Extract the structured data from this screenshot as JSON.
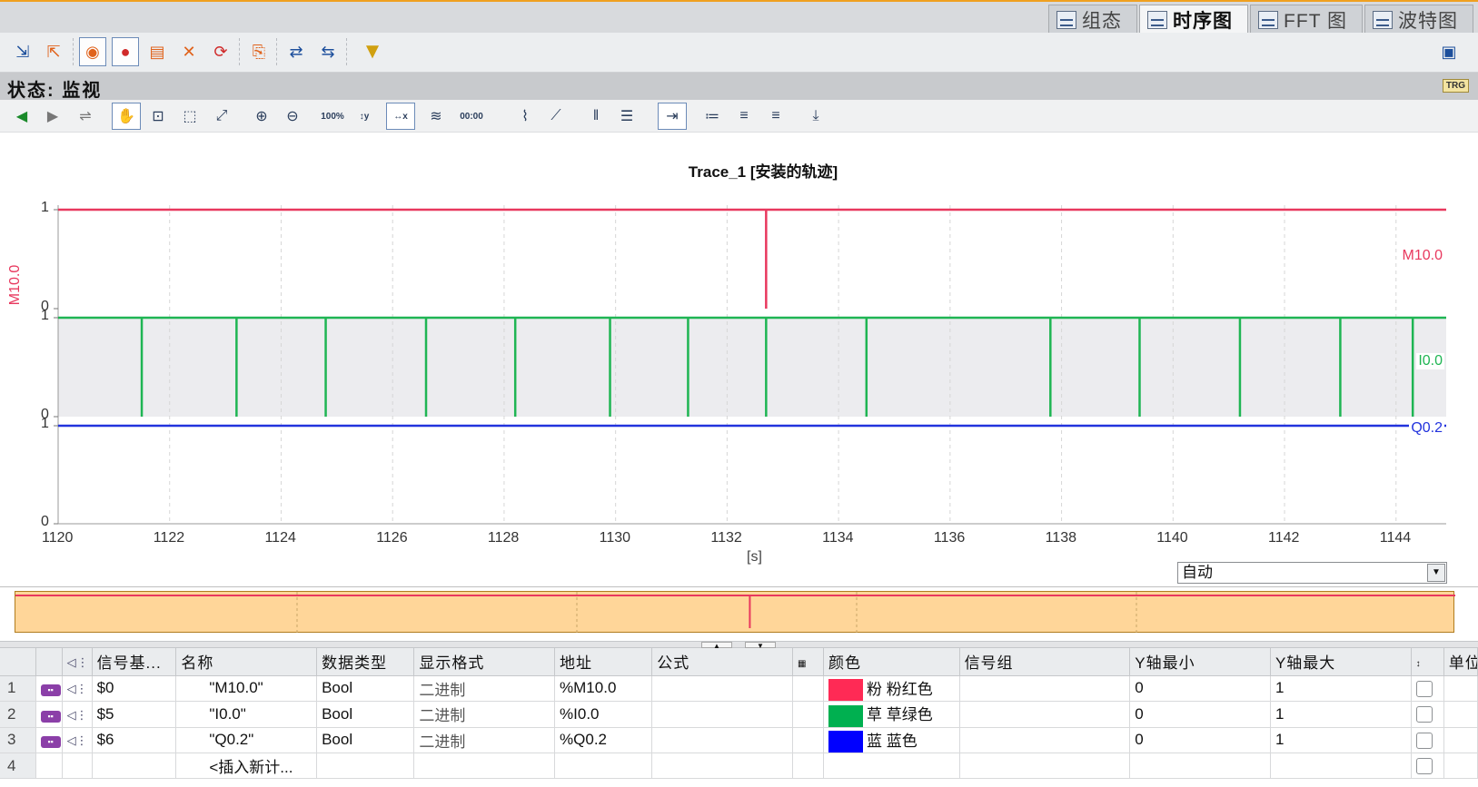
{
  "tabs": [
    {
      "label": "组态",
      "active": false
    },
    {
      "label": "时序图",
      "active": true
    },
    {
      "label": "FFT 图",
      "active": false
    },
    {
      "label": "波特图",
      "active": false
    }
  ],
  "status": {
    "text": "状态: 监视",
    "trigger_badge": "TRG"
  },
  "toolbar_icons": [
    "download-icon",
    "upload-icon",
    "signal-view-icon",
    "signal-record-icon",
    "signal-add-icon",
    "signal-delete-icon",
    "refresh-icon",
    "export-icon",
    "transfer-in-icon",
    "transfer-out-icon",
    "filter-icon"
  ],
  "chart_toolbar_icons": [
    "back-icon",
    "forward-icon",
    "toggle-icon",
    "pan-icon",
    "zoom-area-icon",
    "zoom-box-icon",
    "zoom-fit-icon",
    "zoom-in-icon",
    "zoom-out-icon",
    "zoom-100-icon",
    "zoom-y-100-icon",
    "zoom-x-100-icon",
    "trend-icon",
    "time-measure-icon",
    "fit-curve-icon",
    "diagonal-icon",
    "vertical-cursor-icon",
    "horizontal-cursor-icon",
    "insert-marker-icon",
    "list-icon",
    "align-left-icon",
    "align-right-icon",
    "export-chart-icon"
  ],
  "chart_data": {
    "type": "line",
    "title": "Trace_1 [安装的轨迹]",
    "xlabel": "[s]",
    "ylabel": "M10.0",
    "x_ticks": [
      "1120",
      "1122",
      "1124",
      "1126",
      "1128",
      "1130",
      "1132",
      "1134",
      "1136",
      "1138",
      "1140",
      "1142",
      "1144"
    ],
    "xlim": [
      1120,
      1144.9
    ],
    "series": [
      {
        "name": "M10.0",
        "color": "#e8385e",
        "ylim": [
          0,
          1
        ],
        "y_ticks": [
          "1",
          "0"
        ],
        "baseline": 1,
        "pulses": [
          1132.7
        ]
      },
      {
        "name": "I0.0",
        "color": "#1fb553",
        "ylim": [
          0,
          1
        ],
        "y_ticks": [
          "1",
          "0"
        ],
        "baseline": 1,
        "pulses": [
          1121.5,
          1123.2,
          1124.8,
          1126.6,
          1128.2,
          1129.9,
          1131.3,
          1132.7,
          1134.5,
          1137.8,
          1139.4,
          1141.2,
          1143.0,
          1144.3
        ]
      },
      {
        "name": "Q0.2",
        "color": "#2233dd",
        "ylim": [
          0,
          1
        ],
        "y_ticks": [
          "1",
          "0"
        ],
        "baseline": 1,
        "pulses": []
      }
    ],
    "grid": true
  },
  "time_mode": "自动",
  "table": {
    "headers": [
      "信号基...",
      "名称",
      "数据类型",
      "显示格式",
      "地址",
      "公式",
      "颜色",
      "信号组",
      "Y轴最小",
      "Y轴最大",
      "单位"
    ],
    "rows": [
      {
        "index": "1",
        "symbol": "$0",
        "name": "\"M10.0\"",
        "type": "Bool",
        "format": "二进制",
        "address": "%M10.0",
        "color_hex": "#ff2a55",
        "color_short": "粉",
        "color_name": "粉红色",
        "ymin": "0",
        "ymax": "1"
      },
      {
        "index": "2",
        "symbol": "$5",
        "name": "\"I0.0\"",
        "type": "Bool",
        "format": "二进制",
        "address": "%I0.0",
        "color_hex": "#00b050",
        "color_short": "草",
        "color_name": "草绿色",
        "ymin": "0",
        "ymax": "1"
      },
      {
        "index": "3",
        "symbol": "$6",
        "name": "\"Q0.2\"",
        "type": "Bool",
        "format": "二进制",
        "address": "%Q0.2",
        "color_hex": "#0000ff",
        "color_short": "蓝",
        "color_name": "蓝色",
        "ymin": "0",
        "ymax": "1"
      }
    ],
    "new_row": {
      "index": "4",
      "placeholder": "<插入新计..."
    }
  }
}
